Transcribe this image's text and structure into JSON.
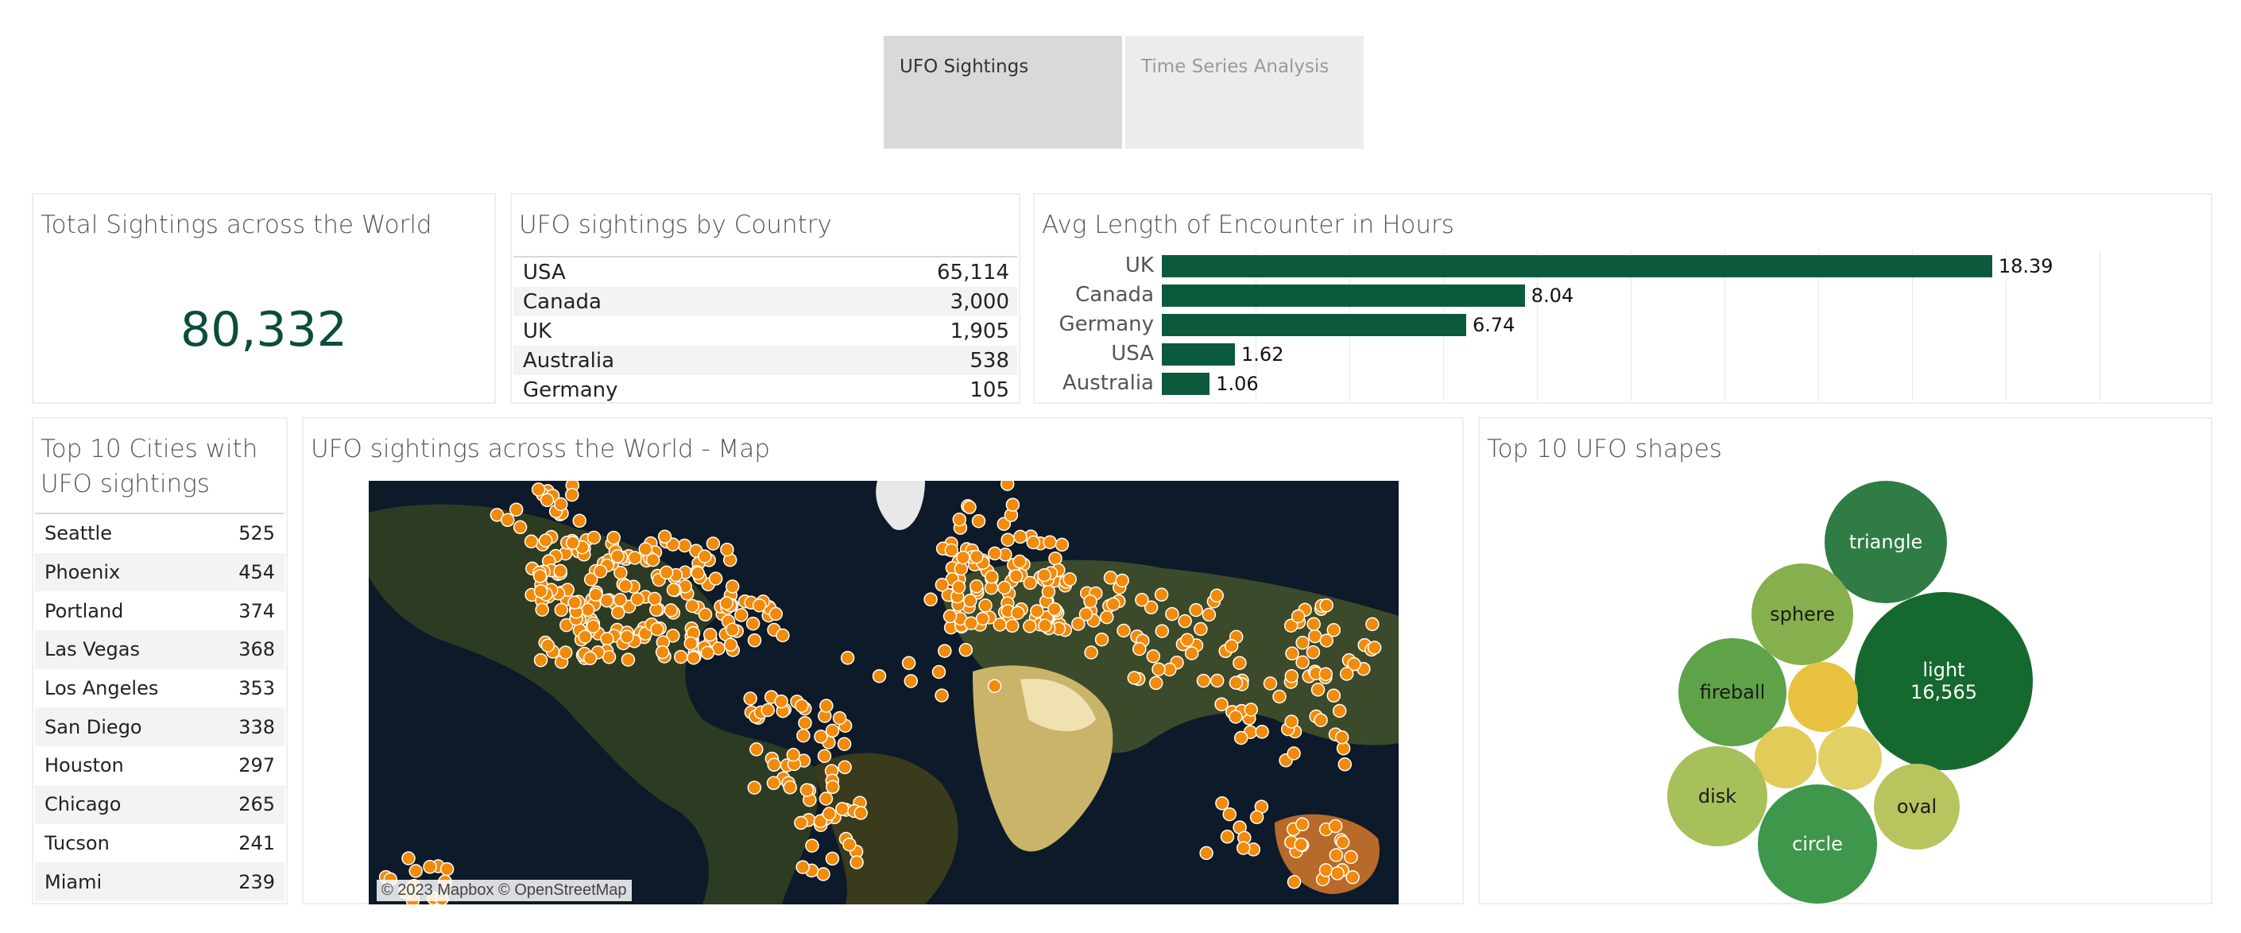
{
  "tabs": [
    {
      "label": "UFO Sightings",
      "active": true
    },
    {
      "label": "Time Series Analysis",
      "active": false
    }
  ],
  "total": {
    "title": "Total Sightings across the World",
    "value": "80,332",
    "color": "#0b4d3a"
  },
  "by_country": {
    "title": "UFO sightings by Country",
    "rows": [
      {
        "country": "USA",
        "count": "65,114"
      },
      {
        "country": "Canada",
        "count": "3,000"
      },
      {
        "country": "UK",
        "count": "1,905"
      },
      {
        "country": "Australia",
        "count": "538"
      },
      {
        "country": "Germany",
        "count": "105"
      }
    ]
  },
  "avg_length": {
    "title": "Avg Length of Encounter in Hours",
    "chart_data": {
      "type": "bar",
      "orientation": "horizontal",
      "categories": [
        "UK",
        "Canada",
        "Germany",
        "USA",
        "Australia"
      ],
      "values": [
        18.39,
        8.04,
        6.74,
        1.62,
        1.06
      ],
      "labels": [
        "18.39",
        "8.04",
        "6.74",
        "1.62",
        "1.06"
      ],
      "bar_color": "#0b5a3c",
      "xlim": [
        0,
        20
      ],
      "grid": true
    }
  },
  "cities": {
    "title_line1": "Top 10 Cities with",
    "title_line2": "UFO sightings",
    "rows": [
      {
        "city": "Seattle",
        "count": "525"
      },
      {
        "city": "Phoenix",
        "count": "454"
      },
      {
        "city": "Portland",
        "count": "374"
      },
      {
        "city": "Las Vegas",
        "count": "368"
      },
      {
        "city": "Los Angeles",
        "count": "353"
      },
      {
        "city": "San Diego",
        "count": "338"
      },
      {
        "city": "Houston",
        "count": "297"
      },
      {
        "city": "Chicago",
        "count": "265"
      },
      {
        "city": "Tucson",
        "count": "241"
      },
      {
        "city": "Miami",
        "count": "239"
      }
    ]
  },
  "map": {
    "title": "UFO sightings across the World - Map",
    "attribution": "© 2023 Mapbox © OpenStreetMap",
    "point_color": "#f28a0a"
  },
  "shapes": {
    "title": "Top 10 UFO shapes",
    "bubbles": [
      {
        "label": "triangle",
        "value": ""
      },
      {
        "label": "sphere",
        "value": ""
      },
      {
        "label": "light",
        "value": "16,565"
      },
      {
        "label": "fireball",
        "value": ""
      },
      {
        "label": "disk",
        "value": ""
      },
      {
        "label": "circle",
        "value": ""
      },
      {
        "label": "oval",
        "value": ""
      },
      {
        "label": "",
        "value": ""
      },
      {
        "label": "",
        "value": ""
      },
      {
        "label": "",
        "value": ""
      }
    ]
  }
}
